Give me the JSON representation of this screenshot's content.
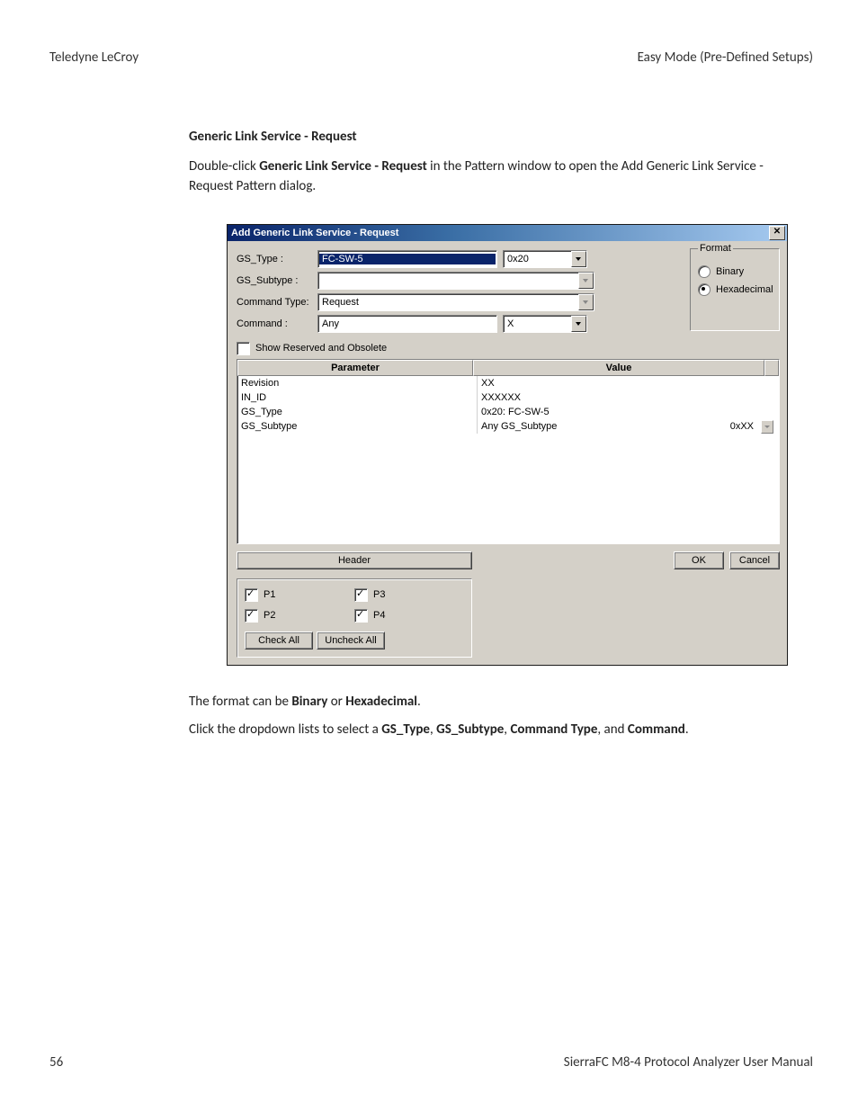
{
  "header": {
    "left": "Teledyne  LeCroy",
    "right": "Easy Mode (Pre-Defined Setups)"
  },
  "section_title": "Generic Link Service - Request",
  "intro": {
    "pre": "Double-click ",
    "bold": "Generic Link Service - Request",
    "post": " in the Pattern window to open the Add Generic Link Service - Request Pattern dialog."
  },
  "dialog": {
    "title": "Add Generic Link Service - Request",
    "close_glyph": "✕",
    "labels": {
      "gs_type": "GS_Type :",
      "gs_subtype": "GS_Subtype :",
      "command_type": "Command Type:",
      "command": "Command :"
    },
    "fields": {
      "gs_type": "FC-SW-5",
      "gs_type_hex": "0x20",
      "gs_subtype": "",
      "command_type": "Request",
      "command": "Any",
      "command_hex": "X"
    },
    "reserved_label": "Show Reserved and Obsolete",
    "table": {
      "head_param": "Parameter",
      "head_value": "Value",
      "rows": [
        {
          "param": "Revision",
          "value": "XX",
          "right": ""
        },
        {
          "param": "IN_ID",
          "value": "XXXXXX",
          "right": ""
        },
        {
          "param": "GS_Type",
          "value": "0x20: FC-SW-5",
          "right": ""
        },
        {
          "param": "GS_Subtype",
          "value": "Any GS_Subtype",
          "right": "0xXX"
        }
      ]
    },
    "buttons": {
      "header": "Header",
      "ok": "OK",
      "cancel": "Cancel",
      "check_all": "Check All",
      "uncheck_all": "Uncheck All"
    },
    "ports": {
      "p1": "P1",
      "p2": "P2",
      "p3": "P3",
      "p4": "P4"
    },
    "format": {
      "legend": "Format",
      "binary": "Binary",
      "hex": "Hexadecimal"
    }
  },
  "para2": {
    "pre": "The format can be ",
    "b1": "Binary",
    "mid": " or ",
    "b2": "Hexadecimal",
    "post": "."
  },
  "para3": {
    "pre": "Click the dropdown lists to select a ",
    "b1": "GS_Type",
    "c1": ", ",
    "b2": "GS_Subtype",
    "c2": ", ",
    "b3": "Command Type",
    "c3": ", and ",
    "b4": "Command",
    "post": "."
  },
  "footer": {
    "page": "56",
    "manual": "SierraFC M8-4 Protocol Analyzer User Manual"
  }
}
